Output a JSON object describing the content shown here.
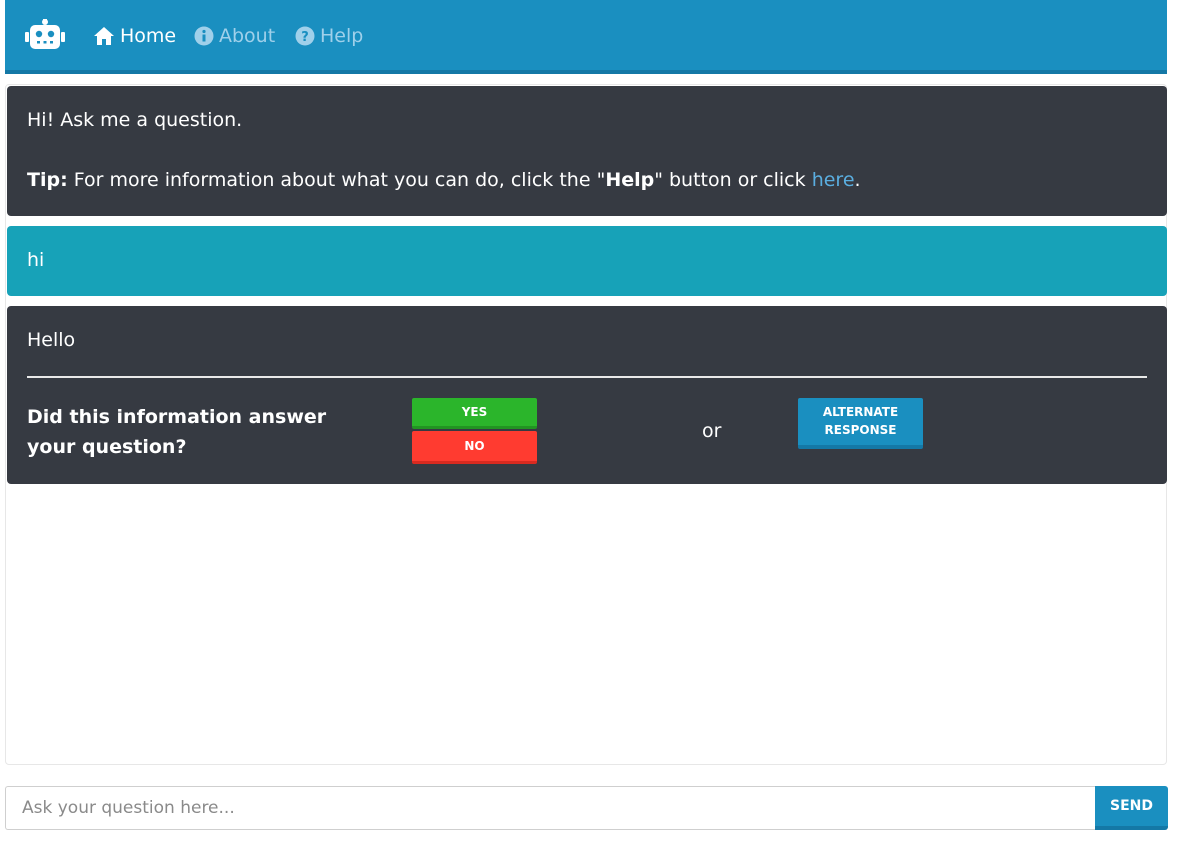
{
  "nav": {
    "items": [
      {
        "label": "Home",
        "icon": "home-icon",
        "active": true
      },
      {
        "label": "About",
        "icon": "info-icon",
        "active": false
      },
      {
        "label": "Help",
        "icon": "help-icon",
        "active": false
      }
    ]
  },
  "messages": {
    "greeting": "Hi! Ask me a question.",
    "tip_label": "Tip:",
    "tip_text_1": "For more information about what you can do, click the \"",
    "tip_bold": "Help",
    "tip_text_2": "\" button or click ",
    "tip_link": "here",
    "tip_end": ".",
    "user_message": "hi",
    "bot_reply": "Hello",
    "feedback_question": "Did this information answer your question?",
    "yes_label": "YES",
    "no_label": "NO",
    "or_text": "or",
    "alt_label": "ALTERNATE RESPONSE"
  },
  "input": {
    "placeholder": "Ask your question here...",
    "send_label": "SEND"
  },
  "colors": {
    "brand": "#1a8fc0",
    "bot_bubble": "#363a42",
    "user_bubble": "#17a2b8",
    "yes": "#2bb52b",
    "no": "#ff3b30",
    "link": "#5aaee0"
  }
}
